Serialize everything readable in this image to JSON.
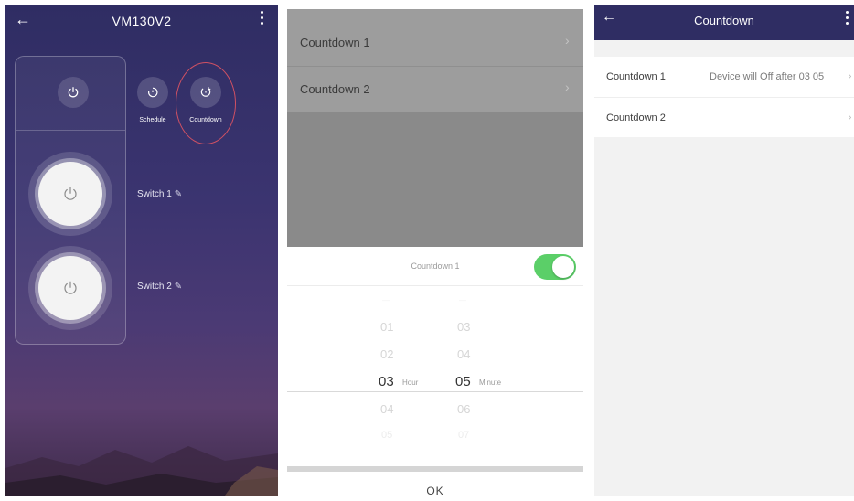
{
  "screen1": {
    "title": "VM130V2",
    "back_icon": "arrow-left-icon",
    "menu_icon": "more-vertical-icon",
    "all_power_icon": "power-icon",
    "schedule": {
      "label": "Schedule",
      "icon": "timer-icon"
    },
    "countdown": {
      "label": "Countdown",
      "icon": "countdown-icon"
    },
    "switches": [
      {
        "label": "Switch 1",
        "icon": "power-icon",
        "edit_icon": "pencil-icon"
      },
      {
        "label": "Switch 2",
        "icon": "power-icon",
        "edit_icon": "pencil-icon"
      }
    ],
    "highlight_color": "#d05163"
  },
  "screen2": {
    "list": [
      {
        "label": "Countdown 1"
      },
      {
        "label": "Countdown 2"
      }
    ],
    "sheet": {
      "title": "Countdown 1",
      "toggle_on": true,
      "toggle_color": "#5bcf68",
      "hour": {
        "above": [
          "01",
          "02"
        ],
        "selected": "03",
        "unit": "Hour",
        "below": [
          "04",
          "05"
        ]
      },
      "minute": {
        "above": [
          "03",
          "04"
        ],
        "selected": "05",
        "unit": "Minute",
        "below": [
          "06",
          "07"
        ]
      },
      "ok_label": "OK"
    }
  },
  "screen3": {
    "title": "Countdown",
    "back_icon": "arrow-left-icon",
    "menu_icon": "more-vertical-icon",
    "rows": [
      {
        "label": "Countdown 1",
        "value": "Device will Off after 03 05"
      },
      {
        "label": "Countdown 2",
        "value": ""
      }
    ],
    "header_color": "#2f2d63"
  }
}
